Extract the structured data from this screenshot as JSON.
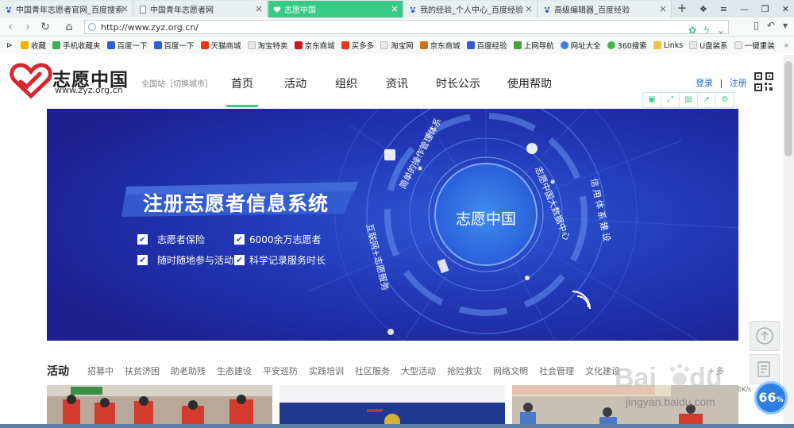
{
  "browser": {
    "tabs": [
      {
        "title": "中国青年志愿者官网_百度搜索",
        "active": false,
        "icon": "paw-icon"
      },
      {
        "title": "中国青年志愿者网",
        "active": false,
        "icon": "page-icon"
      },
      {
        "title": "志愿中国",
        "active": true,
        "icon": "heart-icon"
      },
      {
        "title": "我的经验_个人中心_百度经验",
        "active": false,
        "icon": "paw-icon"
      },
      {
        "title": "高级编辑器_百度经验",
        "active": false,
        "icon": "paw-icon"
      }
    ],
    "new_tab": "+",
    "address": "http://www.zyz.org.cn/",
    "bookmarks": [
      {
        "label": "收藏",
        "color": "#f2b400"
      },
      {
        "label": "手机收藏夹",
        "color": "#3cae5b"
      },
      {
        "label": "百度一下",
        "color": "#2f5fd1"
      },
      {
        "label": "百度一下",
        "color": "#2f5fd1"
      },
      {
        "label": "天猫商城",
        "color": "#e8380d"
      },
      {
        "label": "淘宝特卖",
        "color": "#e8e8e8"
      },
      {
        "label": "京东商城",
        "color": "#c81623"
      },
      {
        "label": "买多多",
        "color": "#e8380d"
      },
      {
        "label": "淘宝网",
        "color": "#e8e8e8"
      },
      {
        "label": "京东商城",
        "color": "#c8741a"
      },
      {
        "label": "百度经验",
        "color": "#2f5fd1"
      },
      {
        "label": "上网导航",
        "color": "#47a33a"
      },
      {
        "label": "网址大全",
        "color": "#3b7de0"
      },
      {
        "label": "360搜索",
        "color": "#44b34a"
      },
      {
        "label": "Links",
        "color": "#f0c24a"
      },
      {
        "label": "U盘装系",
        "color": "#e8e8e8"
      },
      {
        "label": "一键重装",
        "color": "#e8e8e8"
      }
    ]
  },
  "site": {
    "logo_text": "志愿中国",
    "logo_url": "www.zyz.org.cn",
    "region": "全国站［切换城市］",
    "nav": [
      {
        "label": "首页",
        "active": true
      },
      {
        "label": "活动",
        "active": false
      },
      {
        "label": "组织",
        "active": false
      },
      {
        "label": "资讯",
        "active": false
      },
      {
        "label": "时长公示",
        "active": false
      },
      {
        "label": "使用帮助",
        "active": false
      }
    ],
    "login": "登录",
    "separator": "|",
    "register": "注册"
  },
  "banner": {
    "headline": "注册志愿者信息系统",
    "features": [
      "志愿者保险",
      "6000余万志愿者",
      "随时随地参与活动",
      "科学记录服务时长"
    ],
    "center_label": "志愿中国",
    "ring_labels": [
      "简单的操作管理体系",
      "志愿中国大数据中心",
      "信用体系建设",
      "互联网+志愿服务"
    ]
  },
  "activity": {
    "title": "活动",
    "categories": [
      "招募中",
      "扶贫济困",
      "助老助残",
      "生态建设",
      "平安巡防",
      "实践培训",
      "社区服务",
      "大型活动",
      "抢险救灾",
      "网络文明",
      "社会管理",
      "文化建设"
    ],
    "more": "＋多"
  },
  "overlay": {
    "watermark": "jingyan.baidu.com",
    "speed_value": "66",
    "speed_unit": "%",
    "speed_label": "0K/s"
  },
  "colors": {
    "accent": "#39c987",
    "banner_bg": "#1b2fa8",
    "logo_red": "#d8262e",
    "link_blue": "#1f6fc7"
  }
}
